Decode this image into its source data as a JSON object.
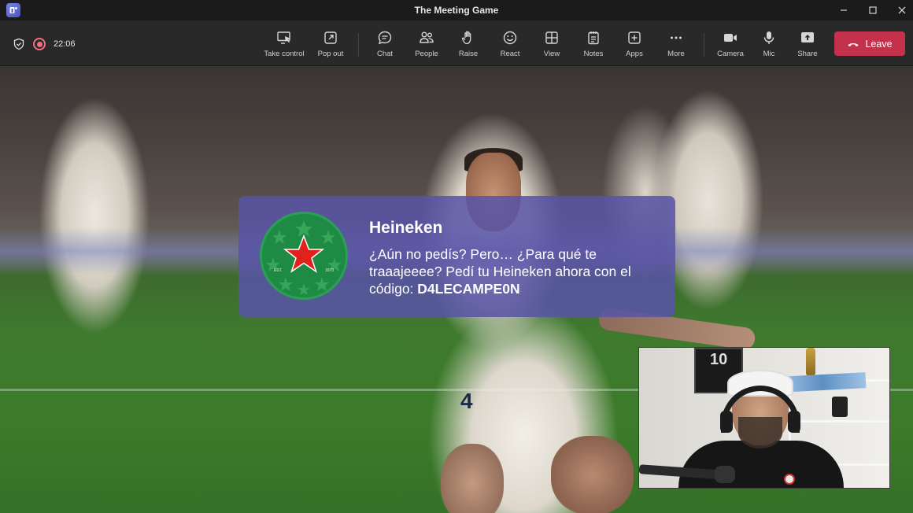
{
  "window": {
    "title": "The Meeting Game",
    "controls": [
      "minimize",
      "maximize",
      "close"
    ]
  },
  "toolbar": {
    "timer": "22:06",
    "buttons": [
      {
        "id": "take-control",
        "label": "Take control",
        "icon": "screen-cursor-icon"
      },
      {
        "id": "pop-out",
        "label": "Pop out",
        "icon": "pop-out-icon"
      },
      {
        "id": "chat",
        "label": "Chat",
        "icon": "chat-icon"
      },
      {
        "id": "people",
        "label": "People",
        "icon": "people-icon"
      },
      {
        "id": "raise",
        "label": "Raise",
        "icon": "hand-icon"
      },
      {
        "id": "react",
        "label": "React",
        "icon": "smiley-icon"
      },
      {
        "id": "view",
        "label": "View",
        "icon": "grid-icon"
      },
      {
        "id": "notes",
        "label": "Notes",
        "icon": "notes-icon"
      },
      {
        "id": "apps",
        "label": "Apps",
        "icon": "plus-box-icon"
      },
      {
        "id": "more",
        "label": "More",
        "icon": "ellipsis-icon"
      },
      {
        "id": "camera",
        "label": "Camera",
        "icon": "camera-icon"
      },
      {
        "id": "mic",
        "label": "Mic",
        "icon": "mic-icon"
      },
      {
        "id": "share",
        "label": "Share",
        "icon": "share-icon"
      }
    ],
    "leave_label": "Leave"
  },
  "notification": {
    "title": "Heineken",
    "body_line": "¿Aún no pedís? Pero… ¿Para qué te traaajeeee? Pedí tu Heineken ahora con el código: ",
    "code": "D4LECAMPE0N",
    "logo_text_left": "EST.",
    "logo_text_right": "1873"
  },
  "stage": {
    "jersey_number": "4"
  },
  "selfview": {
    "frame_number": "10"
  },
  "colors": {
    "leave": "#c4314b",
    "banner": "#5854a6",
    "record": "#f1707b",
    "brand_green": "#1e8a44",
    "brand_star": "#e0221b"
  }
}
